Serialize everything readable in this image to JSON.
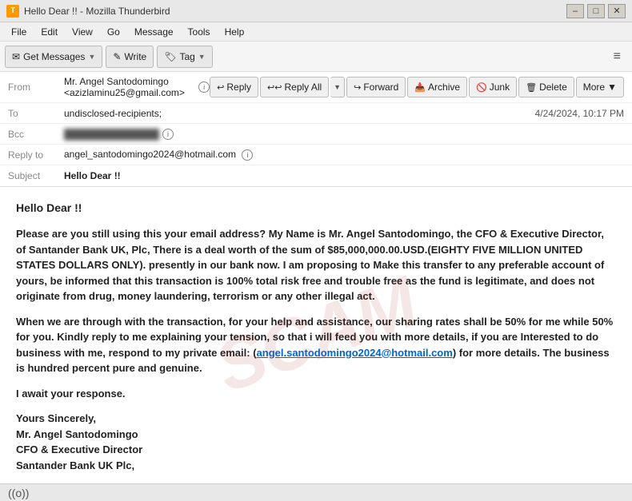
{
  "titleBar": {
    "icon": "T",
    "title": "Hello Dear !! - Mozilla Thunderbird",
    "minimizeLabel": "–",
    "maximizeLabel": "□",
    "closeLabel": "✕"
  },
  "menuBar": {
    "items": [
      "File",
      "Edit",
      "View",
      "Go",
      "Message",
      "Tools",
      "Help"
    ]
  },
  "toolbar": {
    "getMessagesLabel": "Get Messages",
    "writeLabel": "Write",
    "tagLabel": "Tag",
    "hamburgerIcon": "≡"
  },
  "emailToolbar": {
    "replyLabel": "Reply",
    "replyAllLabel": "Reply All",
    "forwardLabel": "Forward",
    "archiveLabel": "Archive",
    "junkLabel": "Junk",
    "deleteLabel": "Delete",
    "moreLabel": "More"
  },
  "emailHeader": {
    "fromLabel": "From",
    "fromValue": "Mr. Angel Santodomingo <azizlaminu25@gmail.com>",
    "toLabel": "To",
    "toValue": "undisclosed-recipients;",
    "bccLabel": "Bcc",
    "bccValue": "██████████████",
    "replyToLabel": "Reply to",
    "replyToValue": "angel_santodomingo2024@hotmail.com",
    "subjectLabel": "Subject",
    "subjectValue": "Hello Dear !!",
    "date": "4/24/2024, 10:17 PM"
  },
  "emailBody": {
    "greeting": "Hello Dear !!",
    "paragraph1": "Please are you still using this your email address? My Name is Mr. Angel Santodomingo, the CFO & Executive Director, of Santander Bank UK, Plc, There is a deal worth of the sum of $85,000,000.00.USD.(EIGHTY FIVE MILLION UNITED STATES DOLLARS ONLY). presently in our bank now. I am proposing to Make this transfer to any preferable account of yours, be informed that this transaction is 100% total risk free and trouble free as the fund is legitimate, and does not originate from drug, money laundering, terrorism or any other illegal act.",
    "paragraph2": "When we are through with the transaction, for your help and assistance, our sharing rates shall be 50% for me while 50% for you. Kindly reply to me explaining your tension, so that i will feed you with more details, if you are Interested to do business with me, respond to my private email: (angel.santodomingo2024@hotmail.com) for more details. The business is hundred percent pure and genuine.",
    "paragraph3": "I await your response.",
    "paragraph4": "Yours Sincerely,\nMr. Angel Santodomingo\nCFO & Executive Director\nSantander Bank UK Plc,",
    "emailLink": "angel.santodomingo2024@hotmail.com"
  },
  "statusBar": {
    "wifiSymbol": "((o))"
  },
  "colors": {
    "accent": "#0066cc",
    "toolbarBg": "#f5f5f5",
    "headerBg": "#ffffff",
    "bodyBg": "#ffffff"
  }
}
